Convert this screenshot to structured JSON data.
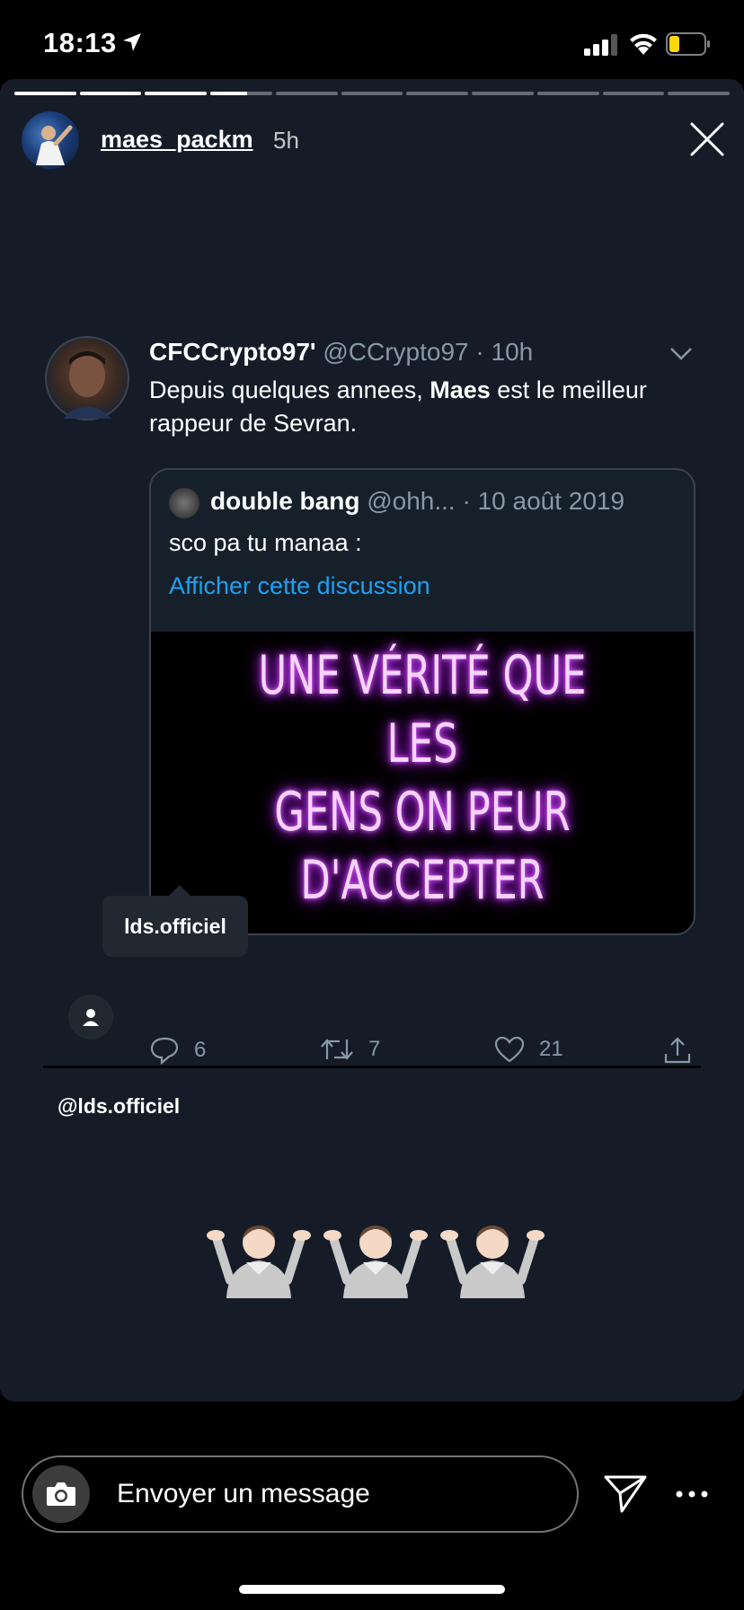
{
  "status_bar": {
    "time": "18:13",
    "icons": [
      "location-arrow-icon",
      "signal-icon",
      "wifi-icon",
      "battery-icon"
    ],
    "battery_color": "#ffd60a"
  },
  "story": {
    "username": "maes_packm",
    "time_ago": "5h",
    "progress": {
      "segments": 11,
      "completed": 3,
      "current_fraction": 0.6
    },
    "background": "#151c28"
  },
  "tweet": {
    "name": "CFCCrypto97'",
    "handle": "@CCrypto97",
    "separator": "·",
    "time": "10h",
    "text_before": "Depuis quelques annees, ",
    "text_bold": "Maes",
    "text_after": " est le meilleur rappeur de Sevran.",
    "quoted": {
      "name": "double bang",
      "handle": "@ohh...",
      "date": "· 10 août 2019",
      "text": "sco pa tu manaa :",
      "link": "Afficher cette discussion",
      "image_text": [
        "UNE VÉRITÉ QUE LES",
        "GENS ON PEUR",
        "D'ACCEPTER"
      ],
      "image_text_color": "#e15cff"
    },
    "actions": {
      "replies": "6",
      "retweets": "7",
      "likes": "21"
    },
    "link_color": "#1da1f2"
  },
  "tag": {
    "bubble_label": "lds.officiel",
    "mention": "@lds.officiel"
  },
  "emoji": [
    "🤷🏻‍♂️",
    "🤷🏻‍♂️",
    "🤷🏻‍♂️"
  ],
  "bottom_bar": {
    "message_placeholder": "Envoyer un message"
  }
}
